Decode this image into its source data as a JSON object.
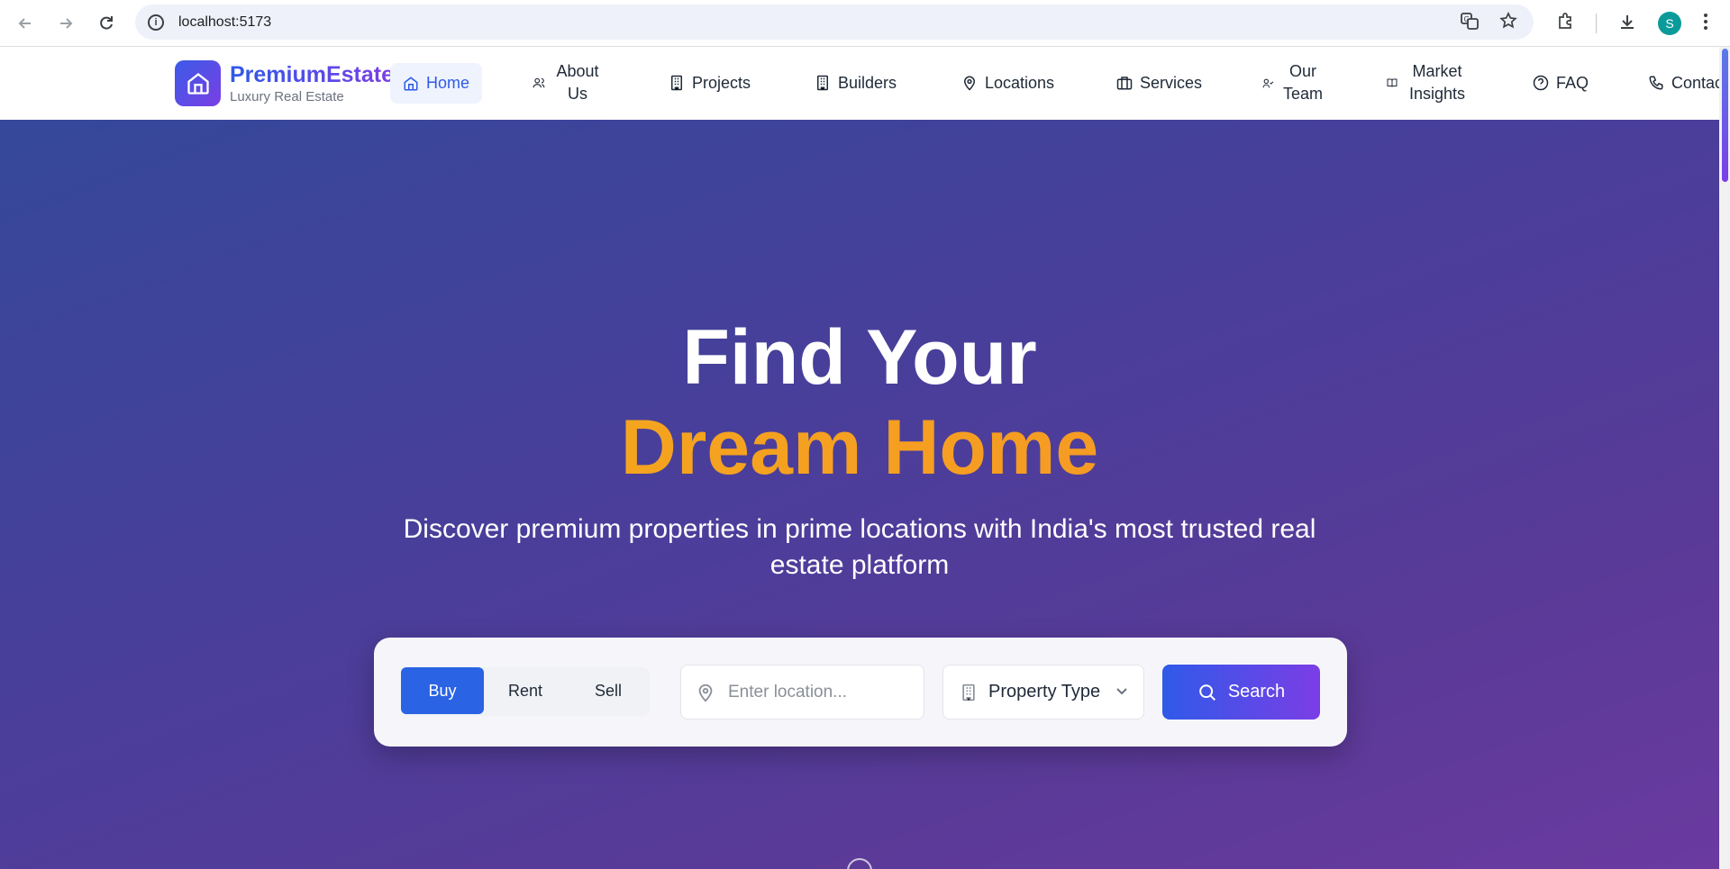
{
  "browser": {
    "url": "localhost:5173",
    "profile_initial": "S",
    "icons": [
      "back-icon",
      "forward-icon",
      "reload-icon",
      "info-icon",
      "translate-icon",
      "star-icon",
      "extensions-icon",
      "download-icon",
      "more-icon"
    ]
  },
  "site": {
    "brand_name": "PremiumEstate",
    "brand_tagline": "Luxury Real Estate",
    "nav": [
      {
        "label": "Home",
        "icon": "home-icon"
      },
      {
        "label": "About Us",
        "icon": "users-icon"
      },
      {
        "label": "Projects",
        "icon": "building-icon"
      },
      {
        "label": "Builders",
        "icon": "building-icon"
      },
      {
        "label": "Locations",
        "icon": "map-pin-icon"
      },
      {
        "label": "Services",
        "icon": "briefcase-icon"
      },
      {
        "label": "Our Team",
        "icon": "user-check-icon"
      },
      {
        "label": "Market Insights",
        "icon": "book-icon"
      },
      {
        "label": "FAQ",
        "icon": "help-circle-icon"
      },
      {
        "label": "Contac",
        "icon": "phone-icon"
      }
    ]
  },
  "hero": {
    "title_line1": "Find Your",
    "title_line2": "Dream Home",
    "subtitle": "Discover premium properties in prime locations with India's most trusted real estate platform"
  },
  "search": {
    "tabs": [
      "Buy",
      "Rent",
      "Sell"
    ],
    "active_tab": "Buy",
    "location_placeholder": "Enter location...",
    "property_type": "Property Type",
    "button_label": "Search"
  },
  "colors": {
    "accent_blue": "#2f5ae8",
    "accent_purple": "#7b3ee6",
    "highlight_orange": "#f5a623"
  }
}
